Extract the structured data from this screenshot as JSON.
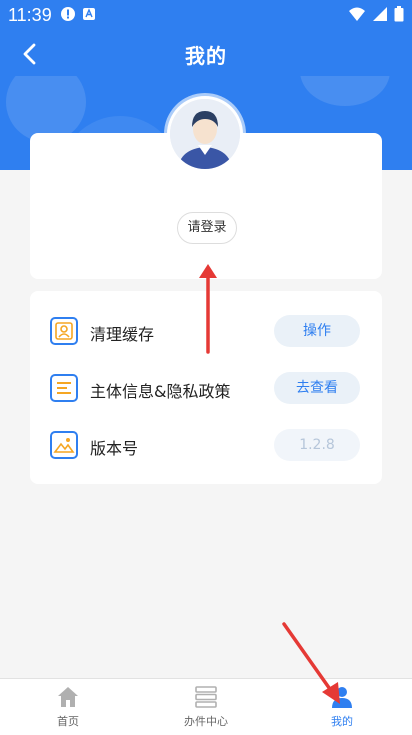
{
  "status_bar": {
    "time": "11:39"
  },
  "header": {
    "title": "我的"
  },
  "profile": {
    "login_label": "请登录"
  },
  "settings": [
    {
      "label": "清理缓存",
      "button": "操作"
    },
    {
      "label": "主体信息&隐私政策",
      "button": "去查看"
    },
    {
      "label": "版本号",
      "value": "1.2.8"
    }
  ],
  "bottom_nav": [
    {
      "label": "首页"
    },
    {
      "label": "办件中心"
    },
    {
      "label": "我的"
    }
  ],
  "colors": {
    "primary": "#2f7ff0",
    "annotation": "#e53935"
  }
}
